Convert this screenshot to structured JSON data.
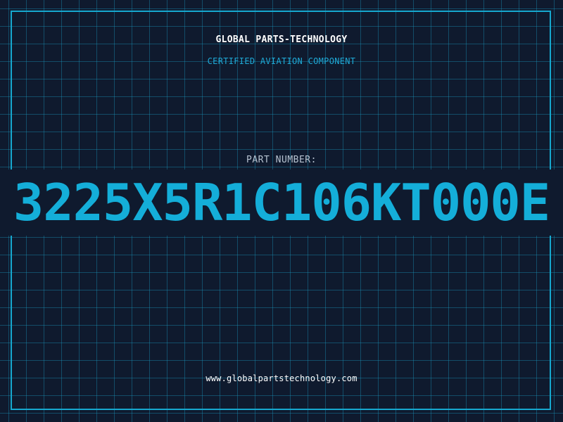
{
  "header": {
    "brand": "GLOBAL PARTS-TECHNOLOGY",
    "subtitle": "CERTIFIED AVIATION COMPONENT"
  },
  "part": {
    "label": "PART NUMBER:",
    "number": "3225X5R1C106KT000E"
  },
  "footer": {
    "url": "www.globalpartstechnology.com"
  },
  "colors": {
    "background": "#0f1a2e",
    "accent": "#14aed9",
    "grid": "#1a9ec4",
    "text": "#ffffff"
  }
}
